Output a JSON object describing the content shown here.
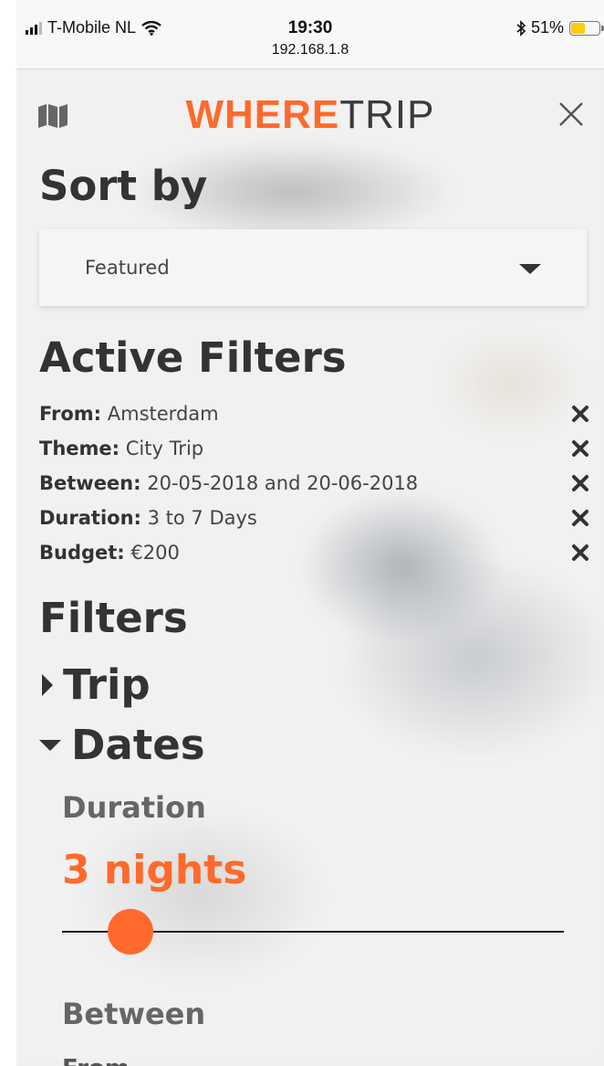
{
  "status_bar": {
    "carrier": "T-Mobile NL",
    "time": "19:30",
    "url": "192.168.1.8",
    "battery_percent": "51%",
    "battery_level": 0.51
  },
  "header": {
    "logo_where": "WHERE",
    "logo_trip": "TRIP"
  },
  "sort": {
    "title": "Sort by",
    "selected": "Featured"
  },
  "active_filters": {
    "title": "Active Filters",
    "items": [
      {
        "label": "From:",
        "value": "Amsterdam"
      },
      {
        "label": "Theme:",
        "value": "City Trip"
      },
      {
        "label": "Between:",
        "value": "20-05-2018 and 20-06-2018"
      },
      {
        "label": "Duration:",
        "value": "3 to 7 Days"
      },
      {
        "label": "Budget:",
        "value": "€200"
      }
    ]
  },
  "filters": {
    "title": "Filters",
    "trip": "Trip",
    "dates": "Dates",
    "duration_label": "Duration",
    "duration_value": "3 nights",
    "between_label": "Between",
    "partial_text": "From"
  },
  "icons": {
    "map": "map-icon",
    "close": "close-icon",
    "remove": "remove-icon",
    "caret_right": "caret-right-icon",
    "caret_down": "caret-down-icon",
    "wifi": "wifi-icon",
    "bluetooth": "bluetooth-icon"
  },
  "colors": {
    "accent": "#ff6a2c",
    "heading": "#333333",
    "battery": "#ffcc00"
  }
}
